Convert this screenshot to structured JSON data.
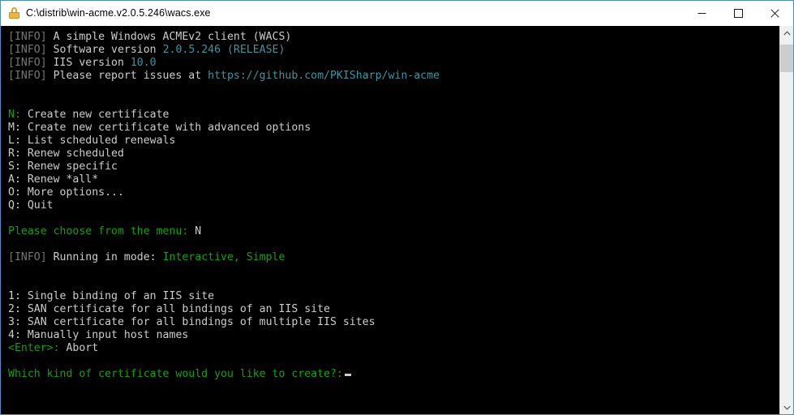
{
  "window": {
    "title": "C:\\distrib\\win-acme.v2.0.5.246\\wacs.exe",
    "lock_icon": "lock-icon",
    "controls": {
      "minimize_label": "Minimize",
      "maximize_label": "Maximize",
      "close_label": "Close"
    },
    "border_color": "#4b8ecb"
  },
  "colors": {
    "console_bg": "#000000",
    "info_prefix": "#767676",
    "default_text": "#cccccc",
    "teal": "#3a96a0",
    "green": "#13a10e",
    "title_bar_bg": "#ffffff",
    "scrollbar_track": "#f0f0f0",
    "scrollbar_thumb": "#cdcdcd",
    "lock_gold": "#f0b43c"
  },
  "console": {
    "header": {
      "info_tag": "[INFO]",
      "line1_text": " A simple Windows ACMEv2 client (WACS)",
      "line2_label": " Software version ",
      "line2_version": "2.0.5.246",
      "line2_sep": " ",
      "line2_release": "(RELEASE)",
      "line3_label": " IIS version ",
      "line3_value": "10.0",
      "line4_label": " Please report issues at ",
      "line4_url": "https://github.com/PKISharp/win-acme"
    },
    "main_menu": [
      {
        "key": "N:",
        "key_color": "green",
        "label": " Create new certificate"
      },
      {
        "key": "M:",
        "key_color": "white",
        "label": " Create new certificate with advanced options"
      },
      {
        "key": "L:",
        "key_color": "white",
        "label": " List scheduled renewals"
      },
      {
        "key": "R:",
        "key_color": "white",
        "label": " Renew scheduled"
      },
      {
        "key": "S:",
        "key_color": "white",
        "label": " Renew specific"
      },
      {
        "key": "A:",
        "key_color": "white",
        "label": " Renew *all*"
      },
      {
        "key": "O:",
        "key_color": "white",
        "label": " More options..."
      },
      {
        "key": "Q:",
        "key_color": "white",
        "label": " Quit"
      }
    ],
    "menu_prompt": {
      "prompt": "Please choose from the menu:",
      "typed_value": " N"
    },
    "mode_line": {
      "info_tag": "[INFO]",
      "label": " Running in mode: ",
      "value": "Interactive, Simple"
    },
    "cert_menu": [
      {
        "key": "1:",
        "key_color": "white",
        "label": " Single binding of an IIS site"
      },
      {
        "key": "2:",
        "key_color": "white",
        "label": " SAN certificate for all bindings of an IIS site"
      },
      {
        "key": "3:",
        "key_color": "white",
        "label": " SAN certificate for all bindings of multiple IIS sites"
      },
      {
        "key": "4:",
        "key_color": "white",
        "label": " Manually input host names"
      },
      {
        "key": "<Enter>:",
        "key_color": "green",
        "label": " Abort"
      }
    ],
    "final_prompt": {
      "prompt": "Which kind of certificate would you like to create?:",
      "typed_value": ""
    }
  },
  "scrollbar": {
    "up_arrow_icon": "chevron-up-icon",
    "down_arrow_icon": "chevron-down-icon",
    "thumb_label": "scrollbar-thumb"
  }
}
